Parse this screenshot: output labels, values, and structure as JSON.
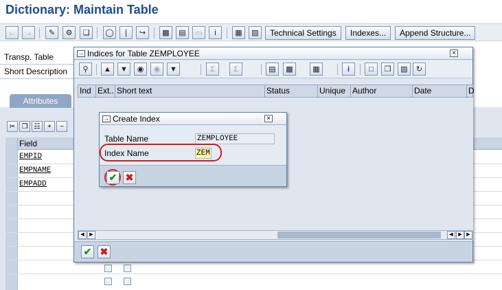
{
  "window": {
    "title": "Dictionary: Maintain Table"
  },
  "toolbar": {
    "technical_settings": "Technical Settings",
    "indexes": "Indexes...",
    "append_structure": "Append Structure..."
  },
  "background": {
    "transp_table_label": "Transp. Table",
    "short_description_label": "Short Description",
    "tab_attributes": "Attributes",
    "field_header": "Field",
    "fields": [
      "EMPID",
      "EMPNAME",
      "EMPADD"
    ]
  },
  "indices_dialog": {
    "title": "Indices for Table ZEMPLOYEE",
    "columns": [
      "Ind",
      "Ext...",
      "Short text",
      "Status",
      "Unique",
      "Author",
      "Date",
      "D"
    ]
  },
  "create_index_dialog": {
    "title": "Create Index",
    "table_name_label": "Table Name",
    "table_name_value": "ZEMPLOYEE",
    "index_name_label": "Index Name",
    "index_name_value": "ZEM"
  },
  "colors": {
    "title_blue": "#1f4d8c",
    "highlight_red": "#d41c1c",
    "input_yellow": "#fff7a8",
    "ok_green": "#2a8a2a",
    "cancel_red": "#c81e1e"
  }
}
